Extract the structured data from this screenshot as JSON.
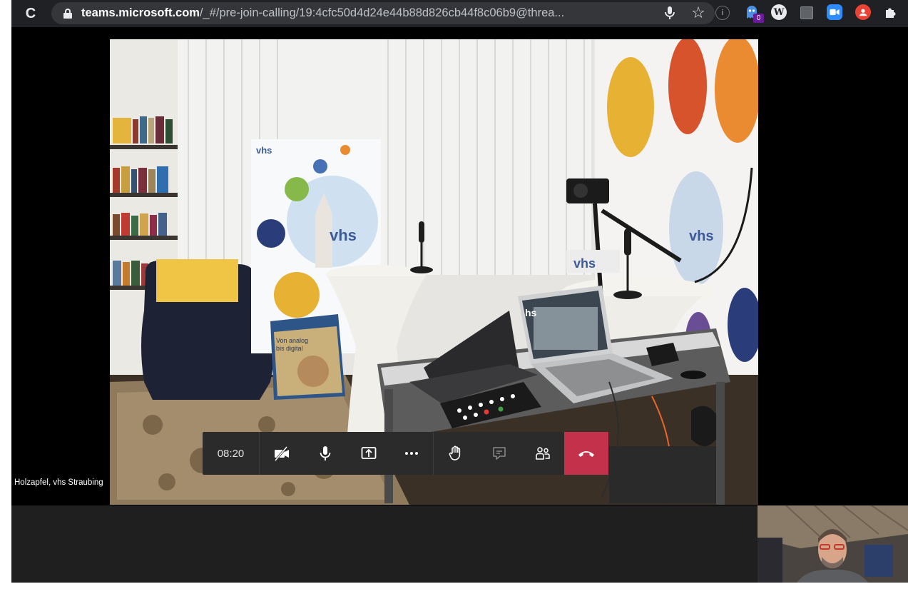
{
  "browser": {
    "url_host": "teams.microsoft.com",
    "url_path": "/_#/pre-join-calling/19:4cfc50d4d24e44b88d826cb44f8c06b9@threa...",
    "extension_badge": "0",
    "extension_w_label": "W"
  },
  "call": {
    "participant_name": "Holzapfel, vhs Straubing",
    "timer": "08:20",
    "scene_texts": {
      "banner_logo": "vhs",
      "banner_logo_2": "vhs",
      "wall_logo": "vhs",
      "box_text_1": "Von analog",
      "box_text_2": "bis digital",
      "laptop_logo": "hs",
      "crate_logo": "vhs"
    }
  },
  "icons": {
    "reload": "reload-icon",
    "lock": "lock-icon",
    "mic": "microphone-icon",
    "star": "bookmark-star-icon",
    "camera_off": "camera-off-icon",
    "share": "share-screen-icon",
    "more": "more-options-icon",
    "raise_hand": "raise-hand-icon",
    "chat": "chat-icon",
    "participants": "participants-icon",
    "hangup": "hang-up-icon"
  },
  "colors": {
    "hangup": "#c4314b",
    "controls_bg": "#2b2b2b",
    "chrome_bg": "#202124"
  }
}
